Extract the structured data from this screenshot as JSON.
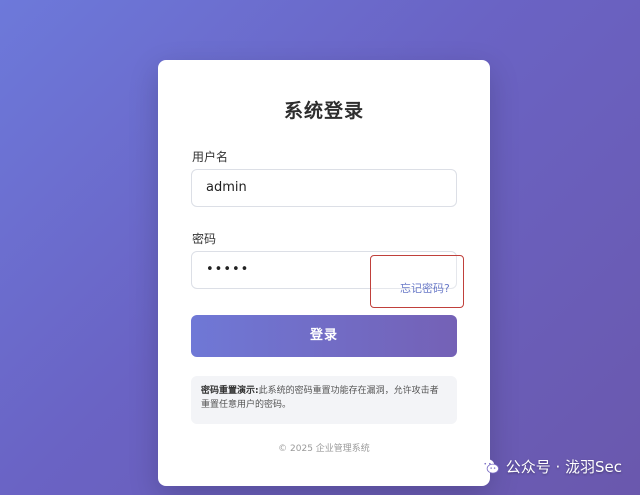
{
  "login": {
    "title": "系统登录",
    "username_label": "用户名",
    "username_value": "admin",
    "password_label": "密码",
    "password_value": "•••••",
    "forgot_password": "忘记密码?",
    "submit_label": "登录",
    "notice_title": "密码重置演示:",
    "notice_text": "此系统的密码重置功能存在漏洞，允许攻击者重置任意用户的密码。",
    "footer": "© 2025 企业管理系统"
  },
  "watermark": {
    "icon": "wechat-icon",
    "text": "公众号 · 泷羽Sec"
  },
  "colors": {
    "background_start": "#6d79da",
    "background_end": "#6a58ad",
    "accent": "#7461b6",
    "highlight_border": "#c0403b",
    "link": "#6b7bc8"
  }
}
